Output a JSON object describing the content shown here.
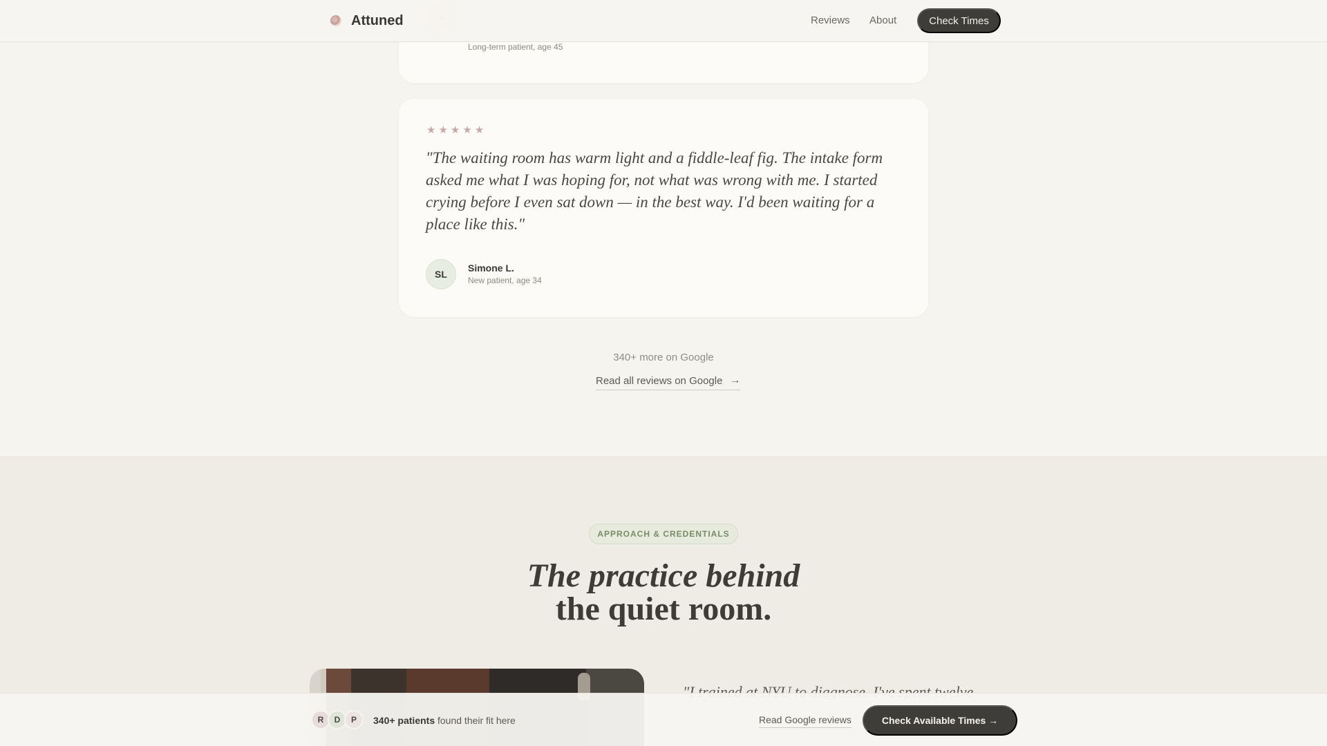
{
  "nav": {
    "brand": "Attuned",
    "links": [
      "Reviews",
      "About"
    ],
    "cta": "Check Times"
  },
  "reviews": [
    {
      "initials": "...",
      "meta": "Long-term patient, age 45"
    },
    {
      "stars": 5,
      "quote": "\"The waiting room has warm light and a fiddle-leaf fig. The intake form asked me what I was hoping for, not what was wrong with me. I started crying before I even sat down — in the best way. I'd been waiting for a place like this.\"",
      "initials": "SL",
      "name": "Simone L.",
      "meta": "New patient, age 34"
    }
  ],
  "more": {
    "count_text": "340+ more on Google",
    "link": "Read all reviews on Google",
    "arrow": "→"
  },
  "approach": {
    "pill": "APPROACH & CREDENTIALS",
    "heading_line1": "The practice behind",
    "heading_line2": "the quiet room.",
    "quote_preview": "\"I trained at NYU to diagnose. I've spent twelve"
  },
  "bottom_bar": {
    "avatars": [
      "R",
      "D",
      "P"
    ],
    "patients_bold": "340+ patients",
    "patients_rest": " found their fit here",
    "read_reviews": "Read Google reviews",
    "cta": "Check Available Times →"
  },
  "colors": {
    "background": "#f6f4ef",
    "dark_button": "#3f3d3a",
    "star": "#c9a9a3",
    "pill_green": "#7b8a66"
  }
}
